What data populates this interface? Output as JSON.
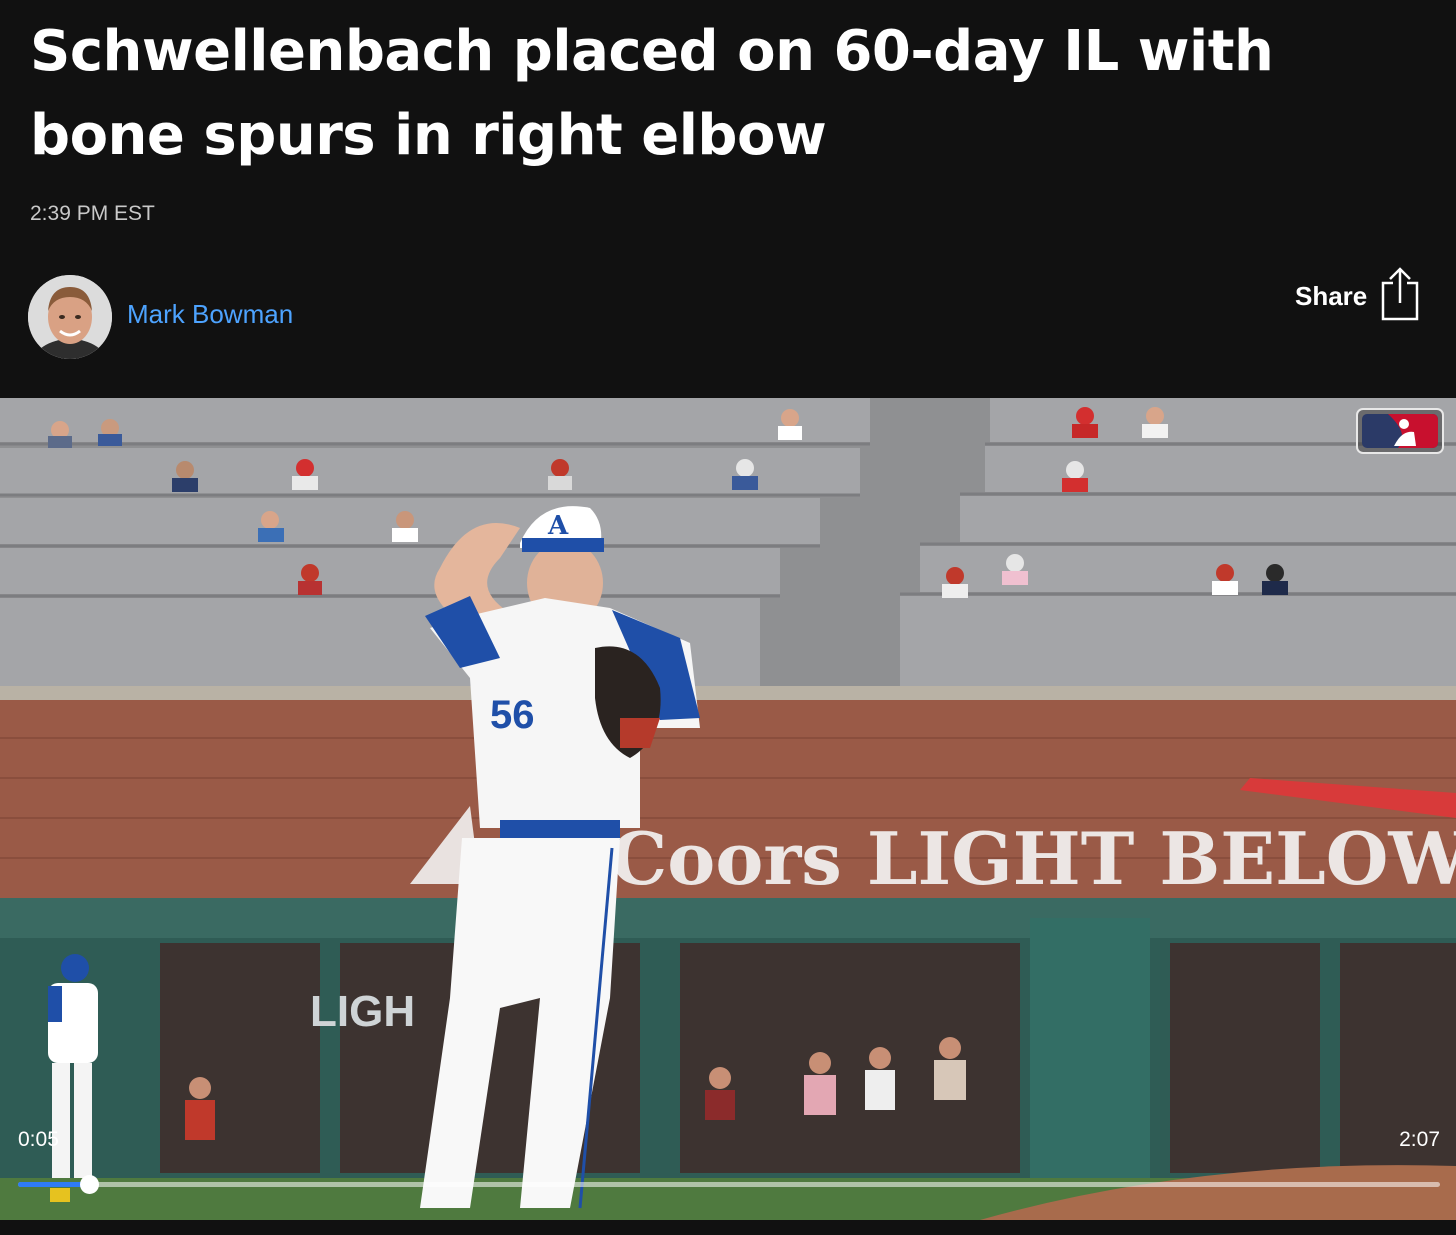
{
  "article": {
    "headline": "Schwellenbach placed on 60-day IL with bone spurs in right elbow",
    "timestamp": "2:39 PM EST"
  },
  "author": {
    "name": "Mark Bowman"
  },
  "share": {
    "label": "Share",
    "icon": "share-icon"
  },
  "video": {
    "elapsed": "0:05",
    "duration": "2:07",
    "progress": 0.05,
    "watermark": "mlb-logo-icon",
    "wall_ad": "Coors LIGHT  BELOW",
    "window_ad": "LIGH",
    "jersey_number": "56",
    "colors": {
      "progress_fill": "#2f7bf5",
      "author_link": "#4da3ff"
    }
  }
}
